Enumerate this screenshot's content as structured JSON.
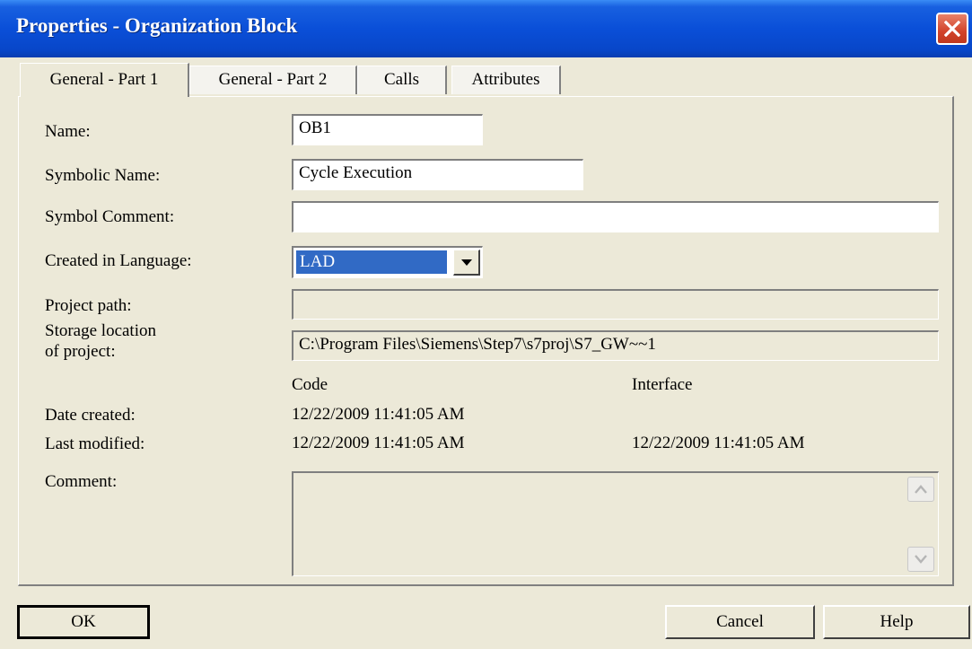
{
  "window": {
    "title": "Properties - Organization Block",
    "close_icon": "close-icon"
  },
  "tabs": [
    {
      "label": "General - Part 1",
      "active": true
    },
    {
      "label": "General - Part 2",
      "active": false
    },
    {
      "label": "Calls",
      "active": false
    },
    {
      "label": "Attributes",
      "active": false
    }
  ],
  "form": {
    "name": {
      "label": "Name:",
      "value": "OB1"
    },
    "symbolic_name": {
      "label": "Symbolic Name:",
      "value": "Cycle Execution"
    },
    "symbol_comment": {
      "label": "Symbol Comment:",
      "value": ""
    },
    "language": {
      "label": "Created in Language:",
      "value": "LAD"
    },
    "project_path": {
      "label": "Project path:",
      "value": ""
    },
    "storage": {
      "label_line1": "Storage location",
      "label_line2": "of project:",
      "value": "C:\\Program Files\\Siemens\\Step7\\s7proj\\S7_GW~~1"
    },
    "col_code": "Code",
    "col_interface": "Interface",
    "date_created": {
      "label": "Date created:",
      "code": "12/22/2009 11:41:05 AM",
      "interface": ""
    },
    "last_modified": {
      "label": "Last modified:",
      "code": "12/22/2009 11:41:05 AM",
      "interface": "12/22/2009 11:41:05 AM"
    },
    "comment": {
      "label": "Comment:",
      "value": ""
    }
  },
  "buttons": {
    "ok": "OK",
    "cancel": "Cancel",
    "help": "Help"
  },
  "colors": {
    "titlebar": "#0a4fd8",
    "face": "#ece9d8",
    "selection": "#316ac5",
    "close": "#d2432a"
  }
}
